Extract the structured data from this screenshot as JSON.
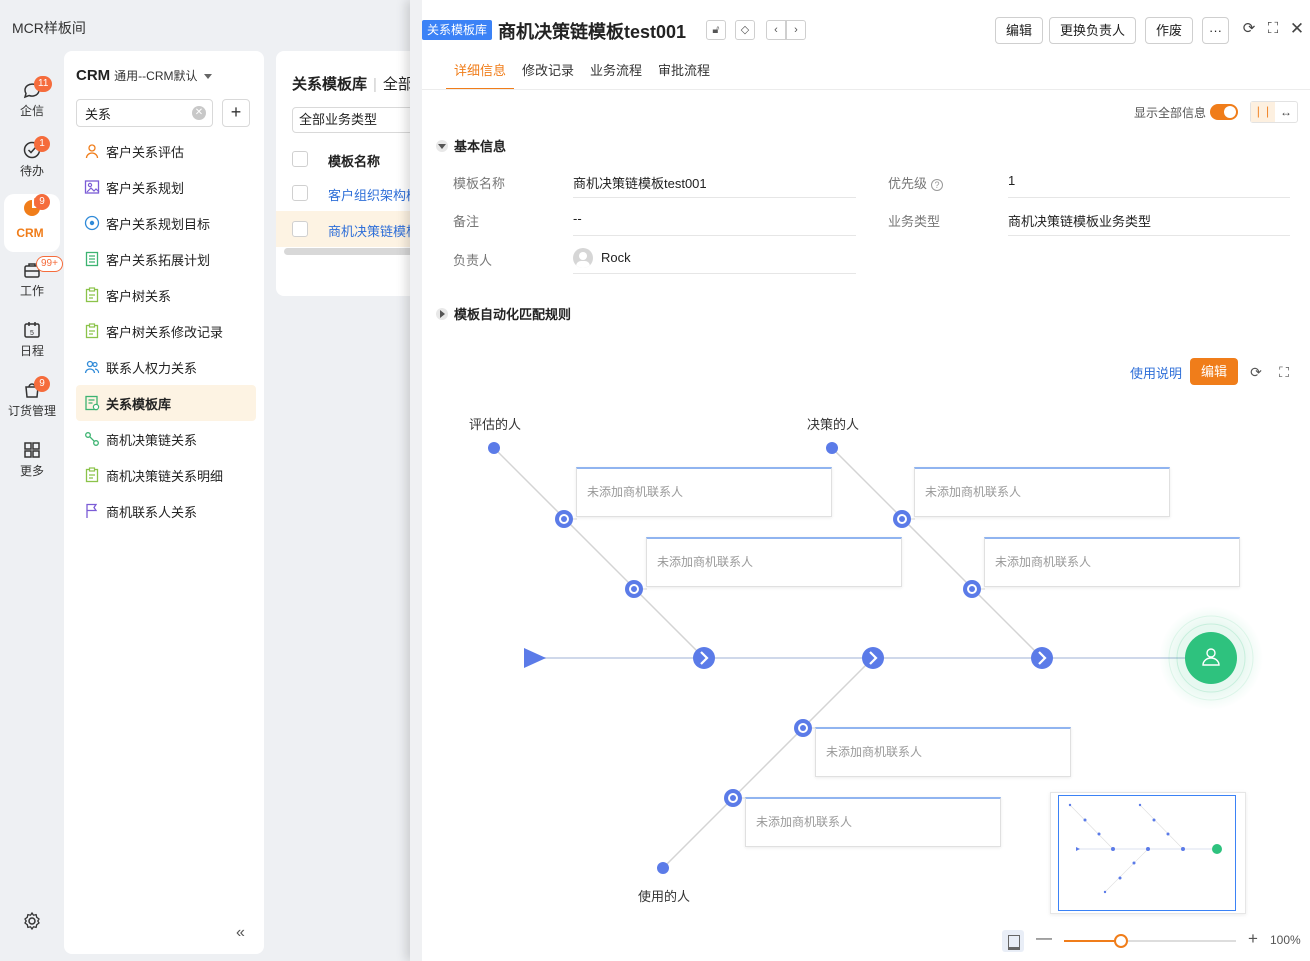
{
  "app": {
    "title": "MCR样板间"
  },
  "rail": {
    "items": [
      {
        "label": "企信",
        "badge": "11",
        "icon": "chat-icon"
      },
      {
        "label": "待办",
        "badge": "1",
        "icon": "check-circle-icon"
      },
      {
        "label": "CRM",
        "badge": "9",
        "icon": "crm-icon",
        "active": true
      },
      {
        "label": "工作",
        "badge": "99+",
        "icon": "briefcase-icon"
      },
      {
        "label": "日程",
        "badge": "",
        "icon": "calendar-icon"
      },
      {
        "label": "订货管理",
        "badge": "9",
        "icon": "bag-icon"
      },
      {
        "label": "更多",
        "badge": "",
        "icon": "grid-icon"
      }
    ]
  },
  "menu": {
    "title": "CRM",
    "subtitle": "通用--CRM默认",
    "search_value": "关系",
    "items": [
      {
        "label": "客户关系评估",
        "icon": "person-icon",
        "color": "#f07d1a"
      },
      {
        "label": "客户关系规划",
        "icon": "picture-icon",
        "color": "#7b5cd6"
      },
      {
        "label": "客户关系规划目标",
        "icon": "target-icon",
        "color": "#2f8ad8"
      },
      {
        "label": "客户关系拓展计划",
        "icon": "list-icon",
        "color": "#3cb371"
      },
      {
        "label": "客户树关系",
        "icon": "clipboard-icon",
        "color": "#8bc34a"
      },
      {
        "label": "客户树关系修改记录",
        "icon": "clipboard-icon",
        "color": "#8bc34a"
      },
      {
        "label": "联系人权力关系",
        "icon": "people-icon",
        "color": "#2f8ad8"
      },
      {
        "label": "关系模板库",
        "icon": "template-icon",
        "color": "#3cb371",
        "active": true
      },
      {
        "label": "商机决策链关系",
        "icon": "link-icon",
        "color": "#3cb371"
      },
      {
        "label": "商机决策链关系明细",
        "icon": "clipboard-icon",
        "color": "#8bc34a"
      },
      {
        "label": "商机联系人关系",
        "icon": "flag-icon",
        "color": "#7b5cd6"
      }
    ]
  },
  "list": {
    "title": "关系模板库",
    "title_rest": "全部",
    "filter": "全部业务类型",
    "header": "模板名称",
    "rows": [
      "客户组织架构模板",
      "商机决策链模板"
    ]
  },
  "detail": {
    "tag": "关系模板库",
    "title": "商机决策链模板test001",
    "buttons": {
      "edit": "编辑",
      "change_owner": "更换负责人",
      "void": "作废",
      "more": "···"
    },
    "tabs": [
      "详细信息",
      "修改记录",
      "业务流程",
      "审批流程"
    ],
    "show_all": "显示全部信息",
    "section_basic": "基本信息",
    "fields": {
      "name_label": "模板名称",
      "name_value": "商机决策链模板test001",
      "priority_label": "优先级",
      "priority_value": "1",
      "note_label": "备注",
      "note_value": "--",
      "biz_label": "业务类型",
      "biz_value": "商机决策链模板业务类型",
      "owner_label": "负责人",
      "owner_value": "Rock"
    },
    "section_rules": "模板自动化匹配规则",
    "help_link": "使用说明",
    "edit_diagram": "编辑"
  },
  "diagram": {
    "labels": {
      "evaluators": "评估的人",
      "deciders": "决策的人",
      "users": "使用的人"
    },
    "empty_box": "未添加商机联系人",
    "accent": "#5b7be8",
    "end_color": "#2ec27e"
  },
  "zoom": {
    "level": "100%",
    "fraction": 0.33
  }
}
